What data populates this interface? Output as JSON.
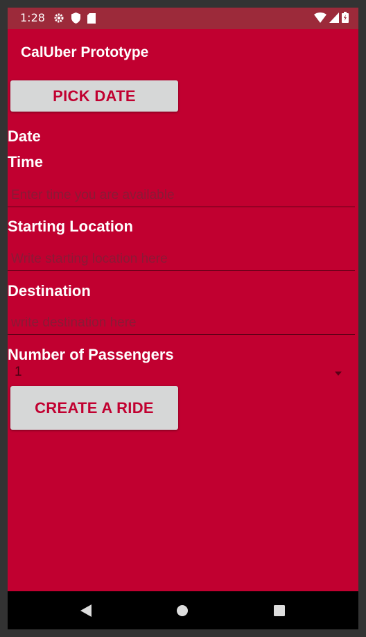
{
  "status_bar": {
    "time": "1:28",
    "left_icons": [
      "gear-icon",
      "shield-icon",
      "sd-card-icon"
    ],
    "right_icons": [
      "wifi-icon",
      "signal-icon",
      "battery-icon"
    ],
    "background": "#9c2a3a"
  },
  "app_bar": {
    "title": "CalUber Prototype",
    "background": "#c10030"
  },
  "form": {
    "pick_date_label": "PICK DATE",
    "date_label": "Date",
    "time_label": "Time",
    "time_placeholder": "Enter time you are available",
    "starting_location_label": "Starting Location",
    "starting_location_placeholder": "Write starting location here",
    "destination_label": "Destination",
    "destination_placeholder": "write destination here",
    "passengers_label": "Number of Passengers",
    "passengers_selected": "1",
    "create_ride_label": "CREATE A RIDE"
  },
  "nav_bar": {
    "buttons": [
      "back-icon",
      "home-icon",
      "recents-icon"
    ]
  },
  "colors": {
    "accent": "#c10030",
    "button_bg": "#d6d7d7",
    "text_on_accent": "#ffffff"
  }
}
